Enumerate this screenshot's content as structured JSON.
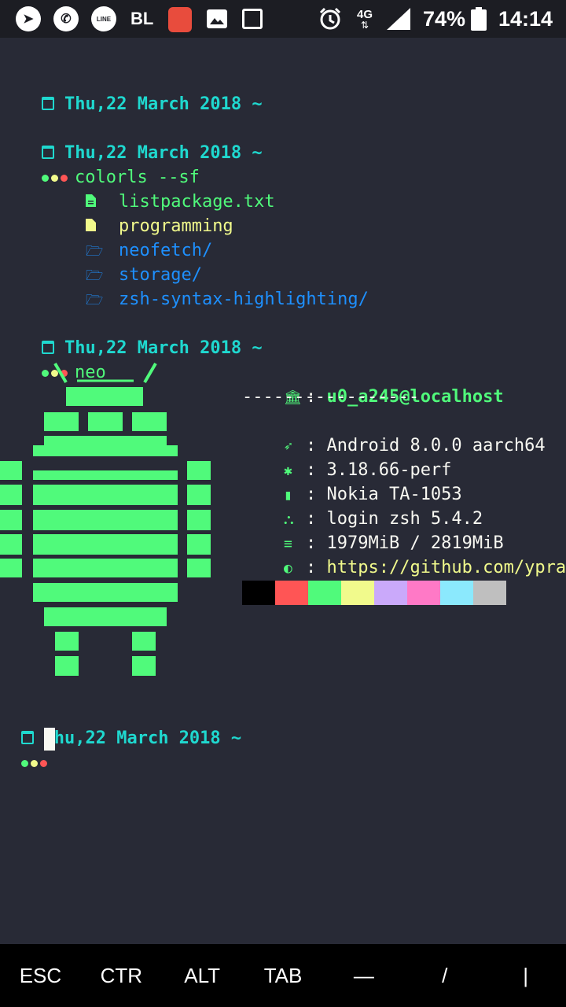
{
  "status_bar": {
    "left_icons": [
      "telegram-icon",
      "whatsapp-icon",
      "line-icon",
      "bl-icon",
      "app-red-icon",
      "gallery-icon",
      "notification-icon"
    ],
    "line_label": "LINE",
    "bl_label": "BL",
    "network": "4G",
    "battery": "74%",
    "time": "14:14"
  },
  "terminal": {
    "prompt_date": "Thu,22 March 2018 ~",
    "commands": {
      "colorls": "colorls --sf",
      "neo": "neo"
    },
    "files": [
      {
        "name": "listpackage.txt",
        "type": "file",
        "color": "#50fa7b",
        "icon": "file-text-icon"
      },
      {
        "name": "programming",
        "type": "file",
        "color": "#f1fa8c",
        "icon": "file-icon"
      },
      {
        "name": "neofetch/",
        "type": "folder",
        "color": "#1e90ff",
        "icon": "folder-icon"
      },
      {
        "name": "storage/",
        "type": "folder",
        "color": "#1e90ff",
        "icon": "folder-icon"
      },
      {
        "name": "zsh-syntax-highlighting/",
        "type": "folder",
        "color": "#1e90ff",
        "icon": "folder-icon"
      }
    ],
    "neofetch": {
      "user": "u0_a245@localhost",
      "separator": "-----------------",
      "os": "Android 8.0.0 aarch64",
      "kernel": "3.18.66-perf",
      "device": "Nokia TA-1053",
      "shell": "login zsh 5.4.2",
      "memory": "1979MiB / 2819MiB",
      "github": "https://github.com/ypraw",
      "palette": [
        "#000000",
        "#ff5555",
        "#50fa7b",
        "#f1fa8c",
        "#caa9fa",
        "#ff79c6",
        "#8be9fd",
        "#bfbfbf"
      ]
    }
  },
  "extra_keys": [
    "ESC",
    "CTR",
    "ALT",
    "TAB",
    "—",
    "/",
    "|"
  ],
  "colors": {
    "background": "#282a36",
    "prompt": "#1fd8cf",
    "accent": "#50fa7b",
    "dot_green": "#50fa7b",
    "dot_yellow": "#f1fa8c",
    "dot_red": "#ff5555"
  }
}
